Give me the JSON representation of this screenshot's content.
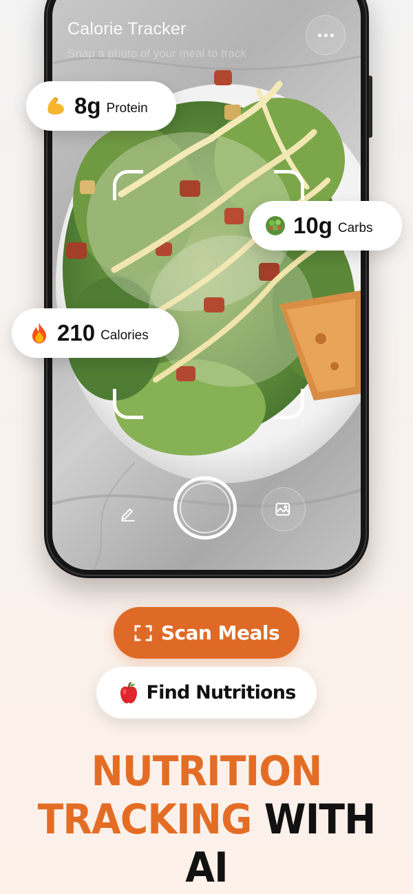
{
  "app": {
    "title": "Calorie Tracker",
    "subtitle": "Snap a photo of your meal to track",
    "menu_icon": "more-horizontal-icon"
  },
  "nutrients": {
    "protein": {
      "emoji_icon": "flexed-biceps-icon",
      "value": "8g",
      "unit": "Protein"
    },
    "carbs": {
      "emoji_icon": "salad-bowl-icon",
      "value": "10g",
      "unit": "Carbs"
    },
    "calories": {
      "emoji_icon": "fire-icon",
      "value": "210",
      "unit": "Calories"
    }
  },
  "camera": {
    "edit_icon": "pencil-icon",
    "shutter_icon": "shutter-icon",
    "gallery_icon": "gallery-icon"
  },
  "actions": {
    "scan_label": "Scan Meals",
    "scan_icon": "scan-frame-icon",
    "find_label": "Find Nutritions",
    "find_icon": "apple-icon"
  },
  "headline": {
    "line1": "NUTRITION",
    "line2_orange": "TRACKING",
    "line2_black": "WITH AI"
  },
  "colors": {
    "accent": "#df6a27",
    "headline_orange": "#e46d26",
    "text_dark": "#111111"
  }
}
